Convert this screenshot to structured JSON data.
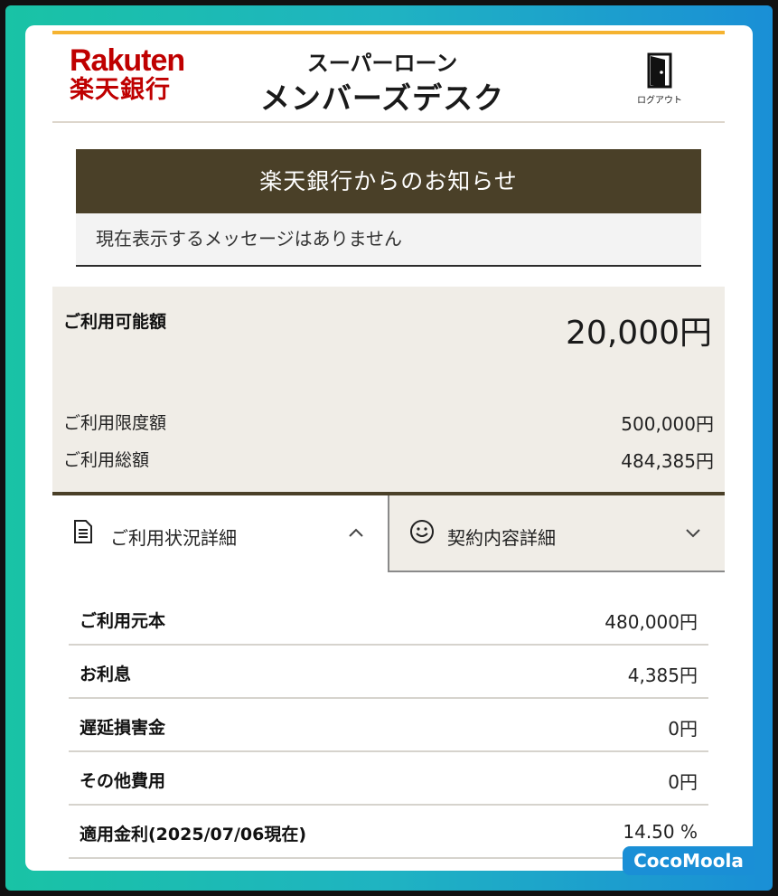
{
  "header": {
    "logo_en": "Rakuten",
    "logo_jp": "楽天銀行",
    "title_line1": "スーパーローン",
    "title_line2": "メンバーズデスク",
    "logout_label": "ログアウト",
    "icon_logout": "door-icon"
  },
  "notice": {
    "title": "楽天銀行からのお知らせ",
    "message": "現在表示するメッセージはありません"
  },
  "summary": {
    "available_label": "ご利用可能額",
    "available_value": "20,000円",
    "limit_label": "ご利用限度額",
    "limit_value": "500,000円",
    "total_label": "ご利用総額",
    "total_value": "484,385円"
  },
  "tabs": [
    {
      "label": "ご利用状況詳細",
      "icon": "document-icon",
      "expanded": true
    },
    {
      "label": "契約内容詳細",
      "icon": "smiley-icon",
      "expanded": false
    }
  ],
  "details": [
    {
      "label": "ご利用元本",
      "value": "480,000円"
    },
    {
      "label": "お利息",
      "value": "4,385円"
    },
    {
      "label": "遅延損害金",
      "value": "0円"
    },
    {
      "label": "その他費用",
      "value": "0円"
    },
    {
      "label": "適用金利(2025/07/06現在)",
      "value": "14.50 %"
    }
  ],
  "watermark": "CocoMoola",
  "colors": {
    "brand_red": "#bf0000",
    "accent_gold": "#f5b330",
    "dark_olive": "#4a4028",
    "summary_bg": "#f0ede7"
  }
}
